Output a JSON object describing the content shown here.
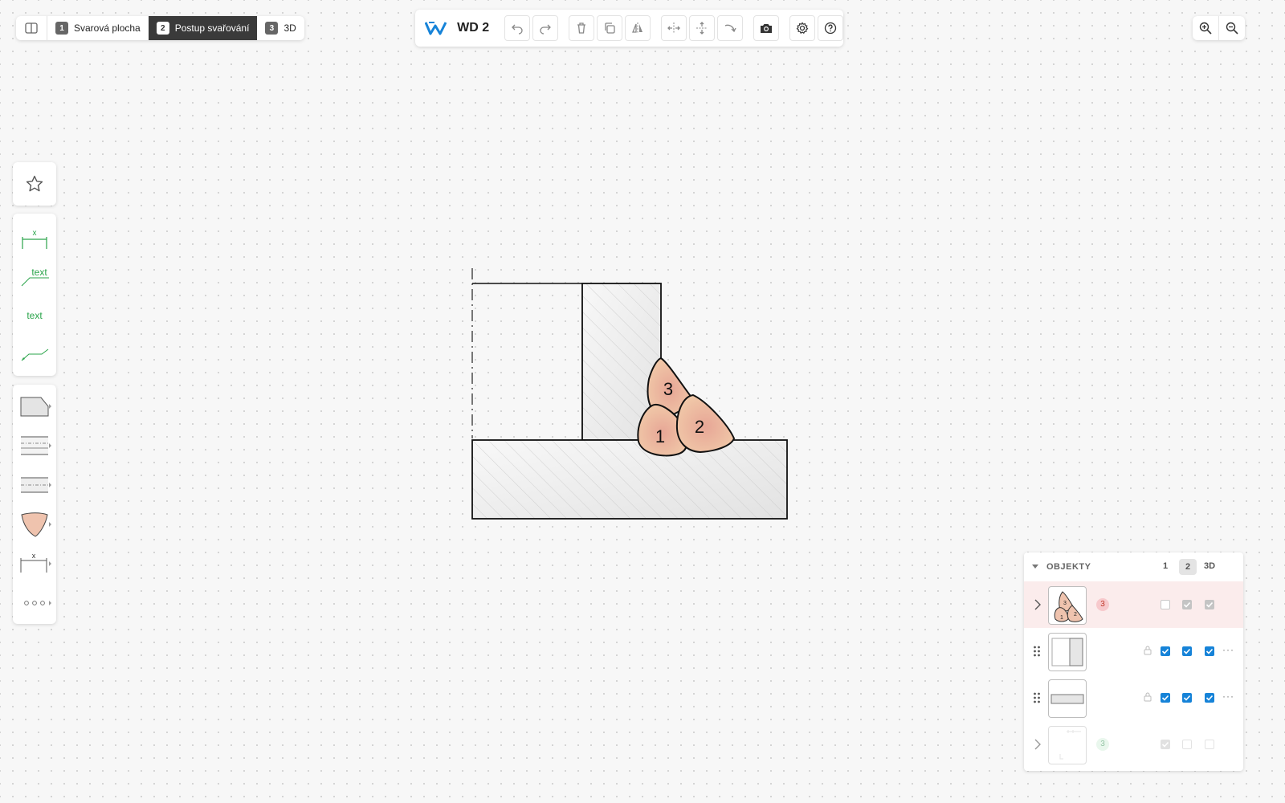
{
  "view_tabs": [
    {
      "num": "1",
      "label": "Svarová plocha"
    },
    {
      "num": "2",
      "label": "Postup svařování"
    },
    {
      "num": "3",
      "label": "3D"
    }
  ],
  "active_tab": "2",
  "toolbar": {
    "title": "WD 2",
    "buttons": [
      "undo-icon",
      "redo-icon",
      "delete-icon",
      "duplicate-icon",
      "mirror-icon",
      "flip-horizontal-icon",
      "flip-vertical-icon",
      "rotate-icon",
      "camera-icon",
      "settings-icon",
      "help-icon"
    ]
  },
  "zoom": {
    "buttons": [
      "zoom-in-icon",
      "zoom-out-icon"
    ]
  },
  "left_tools": {
    "favorites": "star-icon",
    "annotation": [
      {
        "name": "dimension-tool",
        "label": "x"
      },
      {
        "name": "leader-text-tool",
        "label": "text"
      },
      {
        "name": "text-tool",
        "label": "text"
      },
      {
        "name": "leader-line-tool",
        "label": ""
      }
    ],
    "shapes": [
      {
        "name": "plate-shape-tool",
        "label": ""
      },
      {
        "name": "double-line-shape-tool",
        "label": ""
      },
      {
        "name": "centerline-shape-tool",
        "label": ""
      },
      {
        "name": "weld-bead-tool",
        "label": ""
      },
      {
        "name": "gap-dimension-tool",
        "label": "x"
      },
      {
        "name": "more-tools",
        "label": "ooo"
      }
    ]
  },
  "drawing": {
    "weld_passes": [
      {
        "label": "1"
      },
      {
        "label": "2"
      },
      {
        "label": "3"
      }
    ],
    "colors": {
      "weld_fill": "#efc3ae",
      "weld_fill_inner": "#e9a998",
      "outline": "#111111",
      "plate_fill": "#eeeeee"
    }
  },
  "objects_panel": {
    "title": "OBJEKTY",
    "columns": [
      "1",
      "2",
      "3D"
    ],
    "active_column": "2",
    "rows": [
      {
        "type": "weld-group",
        "badge": "3",
        "badge_color": "red",
        "highlighted": true,
        "checks": [
          "empty",
          "grey",
          "grey"
        ],
        "thumb_labels": [
          "3",
          "1",
          "2"
        ]
      },
      {
        "type": "vertical-plate",
        "checks": [
          "blue",
          "blue",
          "blue"
        ],
        "more": "···"
      },
      {
        "type": "horizontal-plate",
        "checks": [
          "blue",
          "blue",
          "blue"
        ],
        "more": "···"
      },
      {
        "type": "annotation-group",
        "badge": "3",
        "badge_color": "green",
        "faded": true,
        "checks": [
          "grey",
          "empty",
          "empty"
        ]
      }
    ]
  }
}
